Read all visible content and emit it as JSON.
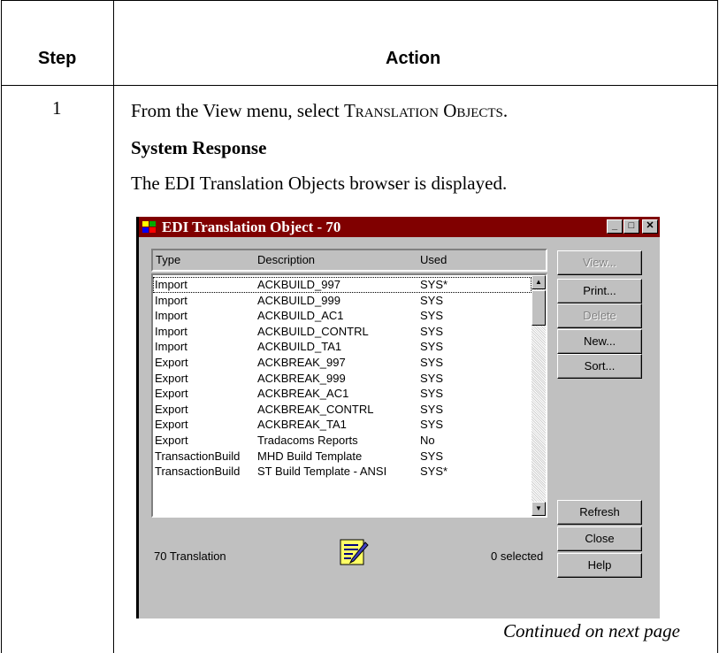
{
  "table": {
    "header_step": "Step",
    "header_action": "Action",
    "step_number": "1",
    "instruction_prefix": "From the View menu, select ",
    "instruction_target": "Translation Objects",
    "instruction_suffix": ".",
    "response_heading": "System Response",
    "response_text": "The EDI Translation Objects browser is displayed.",
    "continued": "Continued on next page"
  },
  "window": {
    "title": "EDI Translation Object - 70",
    "title_bar_color": "#800000",
    "controls": [
      "minimize-icon",
      "maximize-icon",
      "close-icon"
    ],
    "columns": [
      "Type",
      "Description",
      "Used"
    ],
    "rows": [
      {
        "type": "Import",
        "description": "ACKBUILD_997",
        "used": "SYS*"
      },
      {
        "type": "Import",
        "description": "ACKBUILD_999",
        "used": "SYS"
      },
      {
        "type": "Import",
        "description": "ACKBUILD_AC1",
        "used": "SYS"
      },
      {
        "type": "Import",
        "description": "ACKBUILD_CONTRL",
        "used": "SYS"
      },
      {
        "type": "Import",
        "description": "ACKBUILD_TA1",
        "used": "SYS"
      },
      {
        "type": "Export",
        "description": "ACKBREAK_997",
        "used": "SYS"
      },
      {
        "type": "Export",
        "description": "ACKBREAK_999",
        "used": "SYS"
      },
      {
        "type": "Export",
        "description": "ACKBREAK_AC1",
        "used": "SYS"
      },
      {
        "type": "Export",
        "description": "ACKBREAK_CONTRL",
        "used": "SYS"
      },
      {
        "type": "Export",
        "description": "ACKBREAK_TA1",
        "used": "SYS"
      },
      {
        "type": "Export",
        "description": "Tradacoms Reports",
        "used": "No"
      },
      {
        "type": "TransactionBuild",
        "description": "MHD Build Template",
        "used": "SYS"
      },
      {
        "type": "TransactionBuild",
        "description": "ST Build Template - ANSI",
        "used": "SYS*"
      }
    ],
    "buttons": {
      "view": "View...",
      "print": "Print...",
      "delete": "Delete",
      "new": "New...",
      "sort": "Sort...",
      "refresh": "Refresh",
      "close": "Close",
      "help": "Help"
    },
    "status_left": "70 Translation",
    "status_right": "0 selected",
    "status_icon": "document-edit-icon"
  }
}
